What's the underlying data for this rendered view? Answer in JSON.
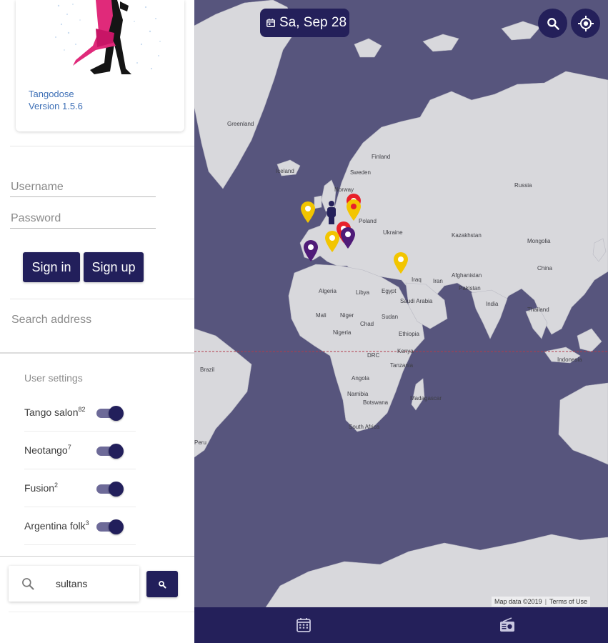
{
  "app": {
    "name": "Tangodose",
    "version": "Version 1.5.6"
  },
  "login": {
    "username_placeholder": "Username",
    "password_placeholder": "Password",
    "signin_label": "Sign in",
    "signup_label": "Sign up"
  },
  "search_address": {
    "placeholder": "Search address"
  },
  "user_settings": {
    "title": "User settings",
    "items": [
      {
        "label": "Tango salon",
        "count": "82",
        "enabled": true
      },
      {
        "label": "Neotango",
        "count": "7",
        "enabled": true
      },
      {
        "label": "Fusion",
        "count": "2",
        "enabled": true
      },
      {
        "label": "Argentina folk",
        "count": "3",
        "enabled": true
      }
    ]
  },
  "search": {
    "value": "sultans",
    "icon": "search-icon"
  },
  "map": {
    "date_label": "Sa, Sep 28",
    "attribution_data": "Map data ©2019",
    "attribution_terms": "Terms of Use",
    "labels": {
      "greenland": "Greenland",
      "iceland": "Iceland",
      "finland": "Finland",
      "sweden": "Sweden",
      "norway": "Norway",
      "poland": "Poland",
      "ukraine": "Ukraine",
      "russia": "Russia",
      "kazakhstan": "Kazakhstan",
      "mongolia": "Mongolia",
      "china": "China",
      "afghanistan": "Afghanistan",
      "pakistan": "Pakistan",
      "iran": "Iran",
      "iraq": "Iraq",
      "saudi_arabia": "Saudi Arabia",
      "india": "India",
      "thailand": "Thailand",
      "algeria": "Algeria",
      "libya": "Libya",
      "egypt": "Egypt",
      "mali": "Mali",
      "niger": "Niger",
      "chad": "Chad",
      "sudan": "Sudan",
      "nigeria": "Nigeria",
      "ethiopia": "Ethiopia",
      "drc": "DRC",
      "kenya": "Kenya",
      "tanzania": "Tanzania",
      "angola": "Angola",
      "namibia": "Namibia",
      "botswana": "Botswana",
      "madagascar": "Madagascar",
      "south_africa": "South Africa",
      "brazil": "Brazil",
      "peru": "Peru",
      "indonesia": "Indonesia"
    }
  },
  "colors": {
    "primary": "#221f5b",
    "map_ocean": "#57557d",
    "map_land": "#d8d8dc",
    "marker_yellow": "#f2c500",
    "marker_red": "#e8202a",
    "marker_purple": "#4f1b78",
    "link_blue": "#3d6fb6"
  },
  "bottom_nav": {
    "calendar_icon": "calendar-icon",
    "radio_icon": "radio-icon"
  }
}
